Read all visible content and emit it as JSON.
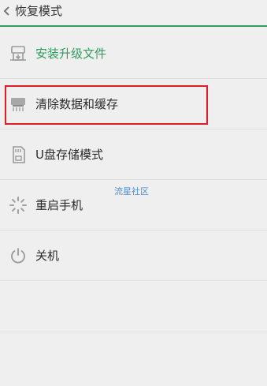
{
  "header": {
    "title": "恢复模式",
    "back_icon": "chevron-left-icon"
  },
  "menu": [
    {
      "label": "安装升级文件",
      "icon": "package-install-icon",
      "active": true
    },
    {
      "label": "清除数据和缓存",
      "icon": "eraser-icon",
      "active": false
    },
    {
      "label": "U盘存储模式",
      "icon": "sd-card-icon",
      "active": false
    },
    {
      "label": "重启手机",
      "icon": "restart-spinner-icon",
      "active": false
    },
    {
      "label": "关机",
      "icon": "power-icon",
      "active": false
    }
  ],
  "watermark": "流星社区",
  "colors": {
    "accent": "#2f9e5c",
    "highlight_border": "#e11c23",
    "watermark": "#4a90d9",
    "text": "#2b2b2b",
    "icon": "#9a9a9a"
  }
}
